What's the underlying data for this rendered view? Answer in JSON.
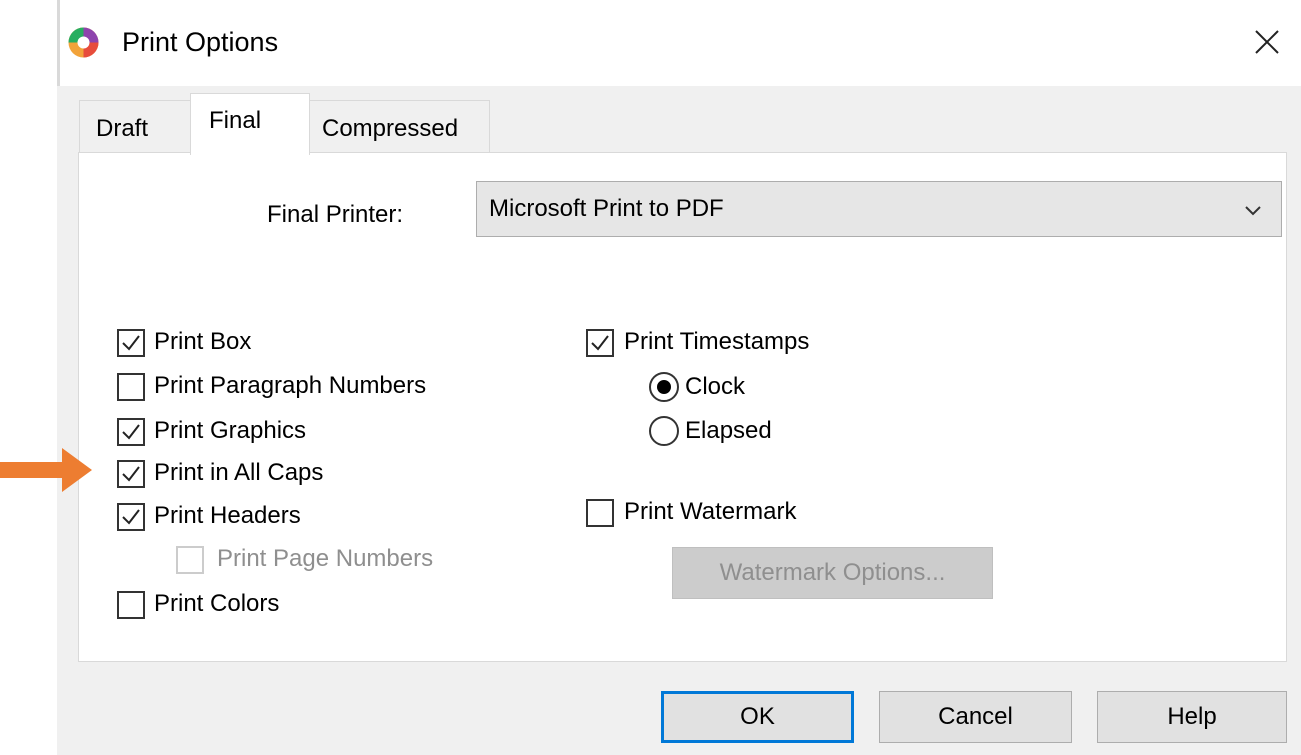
{
  "window": {
    "title": "Print Options",
    "close_icon": "close-icon",
    "app_icon": "app-logo-icon"
  },
  "tabs": [
    {
      "label": "Draft",
      "selected": false
    },
    {
      "label": "Final",
      "selected": true
    },
    {
      "label": "Compressed",
      "selected": false
    }
  ],
  "final_printer": {
    "label": "Final Printer:",
    "value": "Microsoft Print to PDF"
  },
  "left_options": [
    {
      "label": "Print Box",
      "checked": true,
      "enabled": true
    },
    {
      "label": "Print Paragraph Numbers",
      "checked": false,
      "enabled": true
    },
    {
      "label": "Print Graphics",
      "checked": true,
      "enabled": true
    },
    {
      "label": "Print in All Caps",
      "checked": true,
      "enabled": true
    },
    {
      "label": "Print Headers",
      "checked": true,
      "enabled": true
    },
    {
      "label": "Print Page Numbers",
      "checked": false,
      "enabled": false
    },
    {
      "label": "Print Colors",
      "checked": false,
      "enabled": true
    }
  ],
  "timestamps": {
    "label": "Print Timestamps",
    "checked": true,
    "options": [
      {
        "label": "Clock",
        "selected": true
      },
      {
        "label": "Elapsed",
        "selected": false
      }
    ]
  },
  "watermark": {
    "label": "Print Watermark",
    "checked": false,
    "options_button": "Watermark Options..."
  },
  "buttons": {
    "ok": "OK",
    "cancel": "Cancel",
    "help": "Help"
  },
  "colors": {
    "accent": "#0078d7",
    "annotation_arrow": "#ed7d31"
  }
}
